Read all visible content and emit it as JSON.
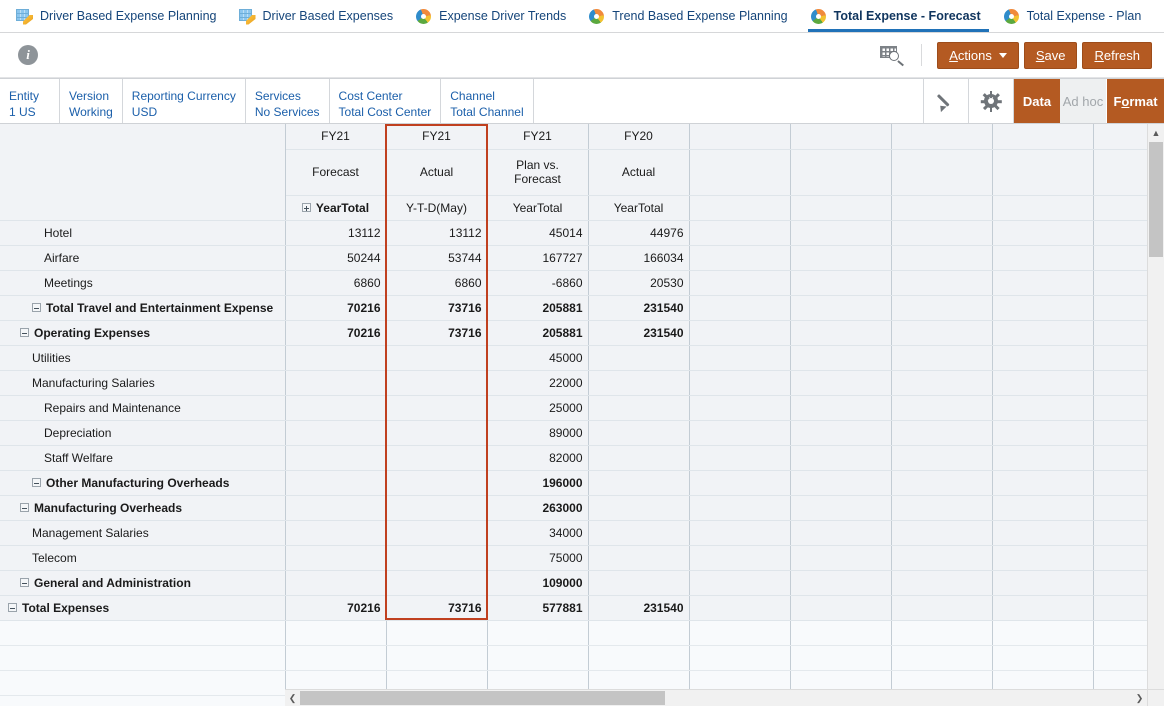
{
  "tabs": [
    {
      "label": "Driver Based Expense Planning",
      "icon": "form-grid-pencil-icon",
      "active": false
    },
    {
      "label": "Driver Based Expenses",
      "icon": "form-grid-pencil-icon",
      "active": false
    },
    {
      "label": "Expense Driver Trends",
      "icon": "pie-chart-icon",
      "active": false
    },
    {
      "label": "Trend Based Expense Planning",
      "icon": "pie-chart-icon",
      "active": false
    },
    {
      "label": "Total Expense - Forecast",
      "icon": "pie-chart-icon",
      "active": true
    },
    {
      "label": "Total Expense - Plan",
      "icon": "pie-chart-icon",
      "active": false
    }
  ],
  "toolbar": {
    "info_icon": "info-icon",
    "data_search_icon": "grid-search-icon",
    "actions_label": "Actions",
    "actions_mnemonic": "A",
    "save_label": "Save",
    "save_mnemonic": "S",
    "refresh_label": "Refresh",
    "refresh_mnemonic": "R"
  },
  "pov": {
    "members": [
      {
        "dimension": "Entity",
        "value": "1 US"
      },
      {
        "dimension": "Version",
        "value": "Working"
      },
      {
        "dimension": "Reporting Currency",
        "value": "USD"
      },
      {
        "dimension": "Services",
        "value": "No Services"
      },
      {
        "dimension": "Cost Center",
        "value": "Total Cost Center"
      },
      {
        "dimension": "Channel",
        "value": "Total Channel"
      }
    ],
    "edit_icon": "pencil-icon",
    "settings_icon": "gear-icon",
    "modes": [
      {
        "label": "Data",
        "state": "selected"
      },
      {
        "label": "Ad hoc",
        "state": "disabled"
      },
      {
        "label": "Format",
        "state": "normal",
        "mnemonic": "o"
      }
    ]
  },
  "grid": {
    "column_headers": {
      "year": [
        "FY21",
        "FY21",
        "FY21",
        "FY20"
      ],
      "scenario": [
        "Forecast",
        "Actual",
        "Plan vs. Forecast",
        "Actual"
      ],
      "period": [
        "YearTotal",
        "Y-T-D(May)",
        "YearTotal",
        "YearTotal"
      ],
      "period_expand": [
        "plus",
        "none",
        "none",
        "none"
      ],
      "period_bold": [
        true,
        false,
        false,
        false
      ]
    },
    "selected_column": "Forecast",
    "empty_column_count": 5,
    "rows": [
      {
        "label": "Hotel",
        "indent": 3,
        "toggle": "none",
        "bold": false,
        "values": [
          "13112",
          "13112",
          "45014",
          "44976"
        ]
      },
      {
        "label": "Airfare",
        "indent": 3,
        "toggle": "none",
        "bold": false,
        "values": [
          "50244",
          "53744",
          "167727",
          "166034"
        ]
      },
      {
        "label": "Meetings",
        "indent": 3,
        "toggle": "none",
        "bold": false,
        "values": [
          "6860",
          "6860",
          "-6860",
          "20530"
        ]
      },
      {
        "label": "Total Travel and Entertainment Expense",
        "indent": 2,
        "toggle": "minus",
        "bold": true,
        "values": [
          "70216",
          "73716",
          "205881",
          "231540"
        ]
      },
      {
        "label": "Operating Expenses",
        "indent": 1,
        "toggle": "minus",
        "bold": true,
        "values": [
          "70216",
          "73716",
          "205881",
          "231540"
        ]
      },
      {
        "label": "Utilities",
        "indent": 2,
        "toggle": "none",
        "bold": false,
        "values": [
          "",
          "",
          "45000",
          ""
        ]
      },
      {
        "label": "Manufacturing Salaries",
        "indent": 2,
        "toggle": "none",
        "bold": false,
        "values": [
          "",
          "",
          "22000",
          ""
        ]
      },
      {
        "label": "Repairs and Maintenance",
        "indent": 3,
        "toggle": "none",
        "bold": false,
        "values": [
          "",
          "",
          "25000",
          ""
        ]
      },
      {
        "label": "Depreciation",
        "indent": 3,
        "toggle": "none",
        "bold": false,
        "values": [
          "",
          "",
          "89000",
          ""
        ]
      },
      {
        "label": "Staff Welfare",
        "indent": 3,
        "toggle": "none",
        "bold": false,
        "values": [
          "",
          "",
          "82000",
          ""
        ]
      },
      {
        "label": "Other Manufacturing Overheads",
        "indent": 2,
        "toggle": "minus",
        "bold": true,
        "values": [
          "",
          "",
          "196000",
          ""
        ]
      },
      {
        "label": "Manufacturing Overheads",
        "indent": 1,
        "toggle": "minus",
        "bold": true,
        "values": [
          "",
          "",
          "263000",
          ""
        ]
      },
      {
        "label": "Management Salaries",
        "indent": 2,
        "toggle": "none",
        "bold": false,
        "values": [
          "",
          "",
          "34000",
          ""
        ]
      },
      {
        "label": "Telecom",
        "indent": 2,
        "toggle": "none",
        "bold": false,
        "values": [
          "",
          "",
          "75000",
          ""
        ]
      },
      {
        "label": "General and Administration",
        "indent": 1,
        "toggle": "minus",
        "bold": true,
        "values": [
          "",
          "",
          "109000",
          ""
        ]
      },
      {
        "label": "Total Expenses",
        "indent": 0,
        "toggle": "minus",
        "bold": true,
        "values": [
          "70216",
          "73716",
          "577881",
          "231540"
        ]
      }
    ],
    "trailing_blank_rows": 3
  },
  "scrollbars": {
    "vertical": {
      "up_arrow": "chevron-up-icon",
      "down_arrow": "chevron-down-icon"
    },
    "horizontal": {
      "left_arrow": "chevron-left-icon",
      "right_arrow": "chevron-right-icon"
    }
  },
  "colors": {
    "accent_orange": "#b45a22",
    "tab_active_underline": "#2072b8",
    "selection_border": "#c0401f",
    "link_blue": "#1b5faa",
    "cell_background": "#f1f3f6"
  }
}
